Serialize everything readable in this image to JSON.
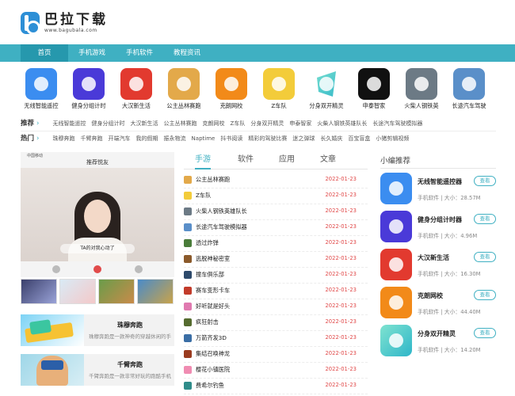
{
  "logo": {
    "name": "巴拉下载",
    "url": "www.bagubala.com"
  },
  "nav": [
    "首页",
    "手机游戏",
    "手机软件",
    "教程资讯"
  ],
  "apps": [
    {
      "name": "无线智能遥控",
      "color": "#3b8df0"
    },
    {
      "name": "健身分组计时",
      "color": "#4a3ad8"
    },
    {
      "name": "大汉新生活",
      "color": "#e23a2f"
    },
    {
      "name": "公主丛林赛跑",
      "color": "#e3a94a"
    },
    {
      "name": "克朗网校",
      "color": "#f28a19"
    },
    {
      "name": "Z车队",
      "color": "#f3cc3a"
    },
    {
      "name": "分身双开精灵",
      "color": "#ffffff"
    },
    {
      "name": "申泰智家",
      "color": "#111111"
    },
    {
      "name": "火柴人钢铁英",
      "color": "#6c7a85"
    },
    {
      "name": "长途汽车驾驶",
      "color": "#5a8fc9"
    }
  ],
  "tags": {
    "recommend_label": "推荐",
    "recommend": [
      "无线智能遥控",
      "健身分组计时",
      "大汉新生活",
      "公主丛林赛跑",
      "克朗网校",
      "Z车队",
      "分身双开精灵",
      "申泰智家",
      "火柴人钢铁英雄队长",
      "长途汽车驾驶模拟器"
    ],
    "hot_label": "热门",
    "hot": [
      "珠穆奔跑",
      "千臂奔跑",
      "开端汽车",
      "我的假期",
      "振永物流",
      "Naptime",
      "抖书阅读",
      "精彩的驾驶比赛",
      "迷之弹球",
      "长久婚庆",
      "百宝盲盒",
      "小猪剪辑视频"
    ]
  },
  "hero": {
    "status": "中国移动",
    "title": "推荐悦友",
    "overlay": "TA的对我心动了"
  },
  "features": [
    {
      "title": "珠穆奔跑",
      "desc": "珠穆奔跑是一款神奇的穿越休闲的手机..."
    },
    {
      "title": "千臂奔跑",
      "desc": "千臂奔跑是一款非常好玩的跑酷手机游..."
    }
  ],
  "tabs": [
    "手游",
    "软件",
    "应用",
    "文章"
  ],
  "list": [
    {
      "name": "公主丛林赛跑",
      "date": "2022-01-23",
      "color": "#e3a94a"
    },
    {
      "name": "Z车队",
      "date": "2022-01-23",
      "color": "#f3cc3a"
    },
    {
      "name": "火柴人钢铁英雄队长",
      "date": "2022-01-23",
      "color": "#6c7a85"
    },
    {
      "name": "长途汽车驾驶模拟器",
      "date": "2022-01-23",
      "color": "#5a8fc9"
    },
    {
      "name": "透过炸弹",
      "date": "2022-01-23",
      "color": "#4a7c3a"
    },
    {
      "name": "逃脱神秘密室",
      "date": "2022-01-23",
      "color": "#8b5a2b"
    },
    {
      "name": "撞车俱乐部",
      "date": "2022-01-23",
      "color": "#2d4a6b"
    },
    {
      "name": "赛车变形卡车",
      "date": "2022-01-23",
      "color": "#c23b2a"
    },
    {
      "name": "好听就是好头",
      "date": "2022-01-23",
      "color": "#e07ab0"
    },
    {
      "name": "疯狂射击",
      "date": "2022-01-23",
      "color": "#556b2f"
    },
    {
      "name": "万箭齐发3D",
      "date": "2022-01-23",
      "color": "#3a6ea5"
    },
    {
      "name": "集结召唤神龙",
      "date": "2022-01-23",
      "color": "#9a3b1f"
    },
    {
      "name": "樱花小镇医院",
      "date": "2022-01-23",
      "color": "#f08cb2"
    },
    {
      "name": "费希尔钓鱼",
      "date": "2022-01-23",
      "color": "#2f8c8a"
    }
  ],
  "recommend": {
    "title": "小编推荐",
    "view_label": "查看",
    "items": [
      {
        "name": "无线智能遥控器",
        "meta": "手机软件 | 大小：28.57M",
        "color": "#3b8df0"
      },
      {
        "name": "健身分组计时器",
        "meta": "手机软件 | 大小：4.96M",
        "color": "#4a3ad8"
      },
      {
        "name": "大汉新生活",
        "meta": "手机软件 | 大小：16.30M",
        "color": "#e23a2f"
      },
      {
        "name": "克朗网校",
        "meta": "手机软件 | 大小：44.40M",
        "color": "#f28a19"
      },
      {
        "name": "分身双开精灵",
        "meta": "手机软件 | 大小：14.20M",
        "color": "#ffffff"
      }
    ]
  }
}
